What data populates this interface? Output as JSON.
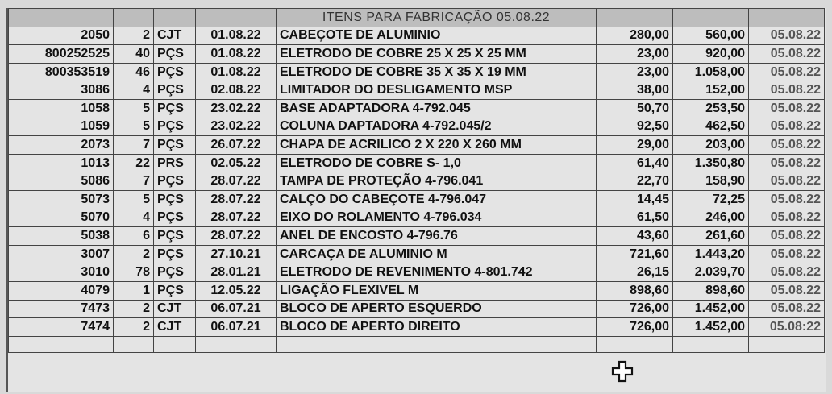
{
  "sheet": {
    "title": "ITENS PARA FABRICAÇÃO 05.08.22",
    "rows": [
      {
        "code": "2050",
        "qty": "2",
        "unit": "CJT",
        "date": "01.08.22",
        "desc": "CABEÇOTE DE ALUMINIO",
        "unit_price": "280,00",
        "total": "560,00",
        "date2": "05.08.22"
      },
      {
        "code": "800252525",
        "qty": "40",
        "unit": "PÇS",
        "date": "01.08.22",
        "desc": "ELETRODO DE COBRE 25 X 25 X 25 MM",
        "unit_price": "23,00",
        "total": "920,00",
        "date2": "05.08.22"
      },
      {
        "code": "800353519",
        "qty": "46",
        "unit": "PÇS",
        "date": "01.08.22",
        "desc": "ELETRODO DE COBRE 35 X 35 X 19 MM",
        "unit_price": "23,00",
        "total": "1.058,00",
        "date2": "05.08.22"
      },
      {
        "code": "3086",
        "qty": "4",
        "unit": "PÇS",
        "date": "02.08.22",
        "desc": "LIMITADOR DO DESLIGAMENTO MSP",
        "unit_price": "38,00",
        "total": "152,00",
        "date2": "05.08.22"
      },
      {
        "code": "1058",
        "qty": "5",
        "unit": "PÇS",
        "date": "23.02.22",
        "desc": "BASE ADAPTADORA 4-792.045",
        "unit_price": "50,70",
        "total": "253,50",
        "date2": "05.08.22"
      },
      {
        "code": "1059",
        "qty": "5",
        "unit": "PÇS",
        "date": "23.02.22",
        "desc": "COLUNA DAPTADORA 4-792.045/2",
        "unit_price": "92,50",
        "total": "462,50",
        "date2": "05.08.22"
      },
      {
        "code": "2073",
        "qty": "7",
        "unit": "PÇS",
        "date": "26.07.22",
        "desc": "CHAPA DE ACRILICO 2 X 220 X 260 MM",
        "unit_price": "29,00",
        "total": "203,00",
        "date2": "05.08.22"
      },
      {
        "code": "1013",
        "qty": "22",
        "unit": "PRS",
        "date": "02.05.22",
        "desc": "ELETRODO DE COBRE S- 1,0",
        "unit_price": "61,40",
        "total": "1.350,80",
        "date2": "05.08.22"
      },
      {
        "code": "5086",
        "qty": "7",
        "unit": "PÇS",
        "date": "28.07.22",
        "desc": "TAMPA DE PROTEÇÃO 4-796.041",
        "unit_price": "22,70",
        "total": "158,90",
        "date2": "05.08.22"
      },
      {
        "code": "5073",
        "qty": "5",
        "unit": "PÇS",
        "date": "28.07.22",
        "desc": "CALÇO DO CABEÇOTE 4-796.047",
        "unit_price": "14,45",
        "total": "72,25",
        "date2": "05.08.22"
      },
      {
        "code": "5070",
        "qty": "4",
        "unit": "PÇS",
        "date": "28.07.22",
        "desc": "EIXO DO ROLAMENTO 4-796.034",
        "unit_price": "61,50",
        "total": "246,00",
        "date2": "05.08.22"
      },
      {
        "code": "5038",
        "qty": "6",
        "unit": "PÇS",
        "date": "28.07.22",
        "desc": "ANEL DE ENCOSTO 4-796.76",
        "unit_price": "43,60",
        "total": "261,60",
        "date2": "05.08.22"
      },
      {
        "code": "3007",
        "qty": "2",
        "unit": "PÇS",
        "date": "27.10.21",
        "desc": "CARCAÇA DE ALUMINIO M",
        "unit_price": "721,60",
        "total": "1.443,20",
        "date2": "05.08.22"
      },
      {
        "code": "3010",
        "qty": "78",
        "unit": "PÇS",
        "date": "28.01.21",
        "desc": "ELETRODO DE REVENIMENTO 4-801.742",
        "unit_price": "26,15",
        "total": "2.039,70",
        "date2": "05.08.22"
      },
      {
        "code": "4079",
        "qty": "1",
        "unit": "PÇS",
        "date": "12.05.22",
        "desc": "LIGAÇÃO FLEXIVEL M",
        "unit_price": "898,60",
        "total": "898,60",
        "date2": "05.08.22"
      },
      {
        "code": "7473",
        "qty": "2",
        "unit": "CJT",
        "date": "06.07.21",
        "desc": "BLOCO DE APERTO ESQUERDO",
        "unit_price": "726,00",
        "total": "1.452,00",
        "date2": "05.08.22"
      },
      {
        "code": "7474",
        "qty": "2",
        "unit": "CJT",
        "date": "06.07.21",
        "desc": "BLOCO DE APERTO DIREITO",
        "unit_price": "726,00",
        "total": "1.452,00",
        "date2": "05.08:22"
      }
    ]
  },
  "icons": {
    "cursor": "cell-select-cross-icon"
  },
  "colors": {
    "background": "#e4e4e4",
    "header": "#bdbdbd",
    "grid": "#444444"
  }
}
